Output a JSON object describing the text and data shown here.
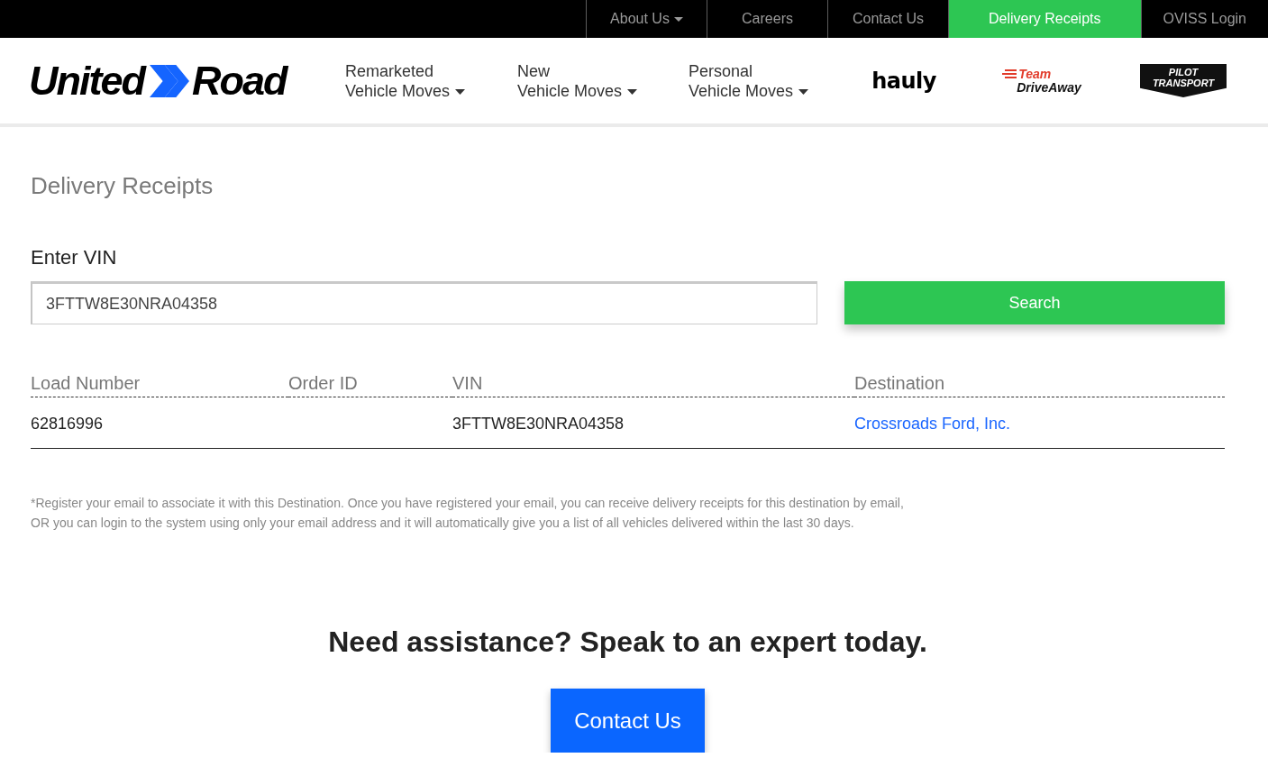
{
  "top_bar": {
    "links": [
      {
        "label": "About Us",
        "dropdown": true,
        "selected": false
      },
      {
        "label": "Careers",
        "dropdown": false,
        "selected": false
      },
      {
        "label": "Contact Us",
        "dropdown": false,
        "selected": false
      },
      {
        "label": "Delivery Receipts",
        "dropdown": false,
        "selected": true
      },
      {
        "label": "OVISS Login",
        "dropdown": false,
        "selected": false
      }
    ]
  },
  "header": {
    "logo": {
      "words": [
        "United",
        "Road"
      ]
    },
    "nav": [
      {
        "lines": [
          "Remarketed",
          "Vehicle Moves"
        ],
        "dropdown": true
      },
      {
        "lines": [
          "New",
          "Vehicle Moves"
        ],
        "dropdown": true
      },
      {
        "lines": [
          "Personal",
          "Vehicle Moves"
        ],
        "dropdown": true
      }
    ],
    "partner_logos": [
      {
        "kind": "hauly",
        "words": [
          "hauly"
        ]
      },
      {
        "kind": "team",
        "words": [
          "Team",
          "DriveAway"
        ]
      },
      {
        "kind": "pilot",
        "words": [
          "PILOT",
          "TRANSPORT"
        ]
      }
    ]
  },
  "page_title": "Delivery Receipts",
  "vin_form": {
    "label": "Enter VIN",
    "value": "3FTTW8E30NRA04358",
    "button": "Search"
  },
  "results_table": {
    "columns": [
      "Load Number",
      "Order ID",
      "VIN",
      "Destination"
    ],
    "rows": [
      {
        "load_number": "62816996",
        "vin": "3FTTW8E30NRA04358",
        "destination": "Crossroads Ford, Inc."
      }
    ]
  },
  "note": "*Register your email to associate it with this Destination. Once you have registered your email, you can receive delivery receipts for this destination by email, OR you can login to the system using only your email address and it will automatically give you a list of all vehicles delivered within the last 30 days.",
  "cta": {
    "heading": "Need assistance? Speak to an expert today.",
    "button": "Contact Us"
  }
}
